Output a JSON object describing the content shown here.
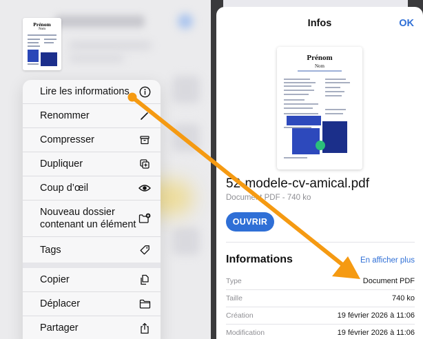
{
  "thumbnail": {
    "name": "Prénom",
    "subtitle": "Nom"
  },
  "context_menu": {
    "items": [
      {
        "label": "Lire les informations",
        "icon": "info-icon"
      },
      {
        "label": "Renommer",
        "icon": "pencil-icon"
      },
      {
        "label": "Compresser",
        "icon": "archive-box-icon"
      },
      {
        "label": "Dupliquer",
        "icon": "duplicate-icon"
      },
      {
        "label": "Coup d’œil",
        "icon": "eye-icon"
      },
      {
        "label": "Nouveau dossier contenant un élément",
        "icon": "folder-plus-icon"
      },
      {
        "label": "Tags",
        "icon": "tag-icon"
      },
      {
        "label": "Copier",
        "icon": "copy-doc-icon"
      },
      {
        "label": "Déplacer",
        "icon": "folder-icon"
      },
      {
        "label": "Partager",
        "icon": "share-icon"
      }
    ]
  },
  "info_sheet": {
    "title": "Infos",
    "ok_label": "OK",
    "preview": {
      "name": "Prénom",
      "subtitle": "Nom"
    },
    "file_name": "52-modele-cv-amical.pdf",
    "file_meta": "Document PDF - 740 ko",
    "open_label": "OUVRIR",
    "section_title": "Informations",
    "show_more_label": "En afficher plus",
    "rows": [
      {
        "key": "Type",
        "value": "Document PDF"
      },
      {
        "key": "Taille",
        "value": "740 ko"
      },
      {
        "key": "Création",
        "value": "19 février 2026 à 11:06"
      },
      {
        "key": "Modification",
        "value": "19 février 2026 à 11:06"
      }
    ]
  },
  "colors": {
    "accent": "#2f6fd6",
    "arrow": "#f59a12"
  }
}
